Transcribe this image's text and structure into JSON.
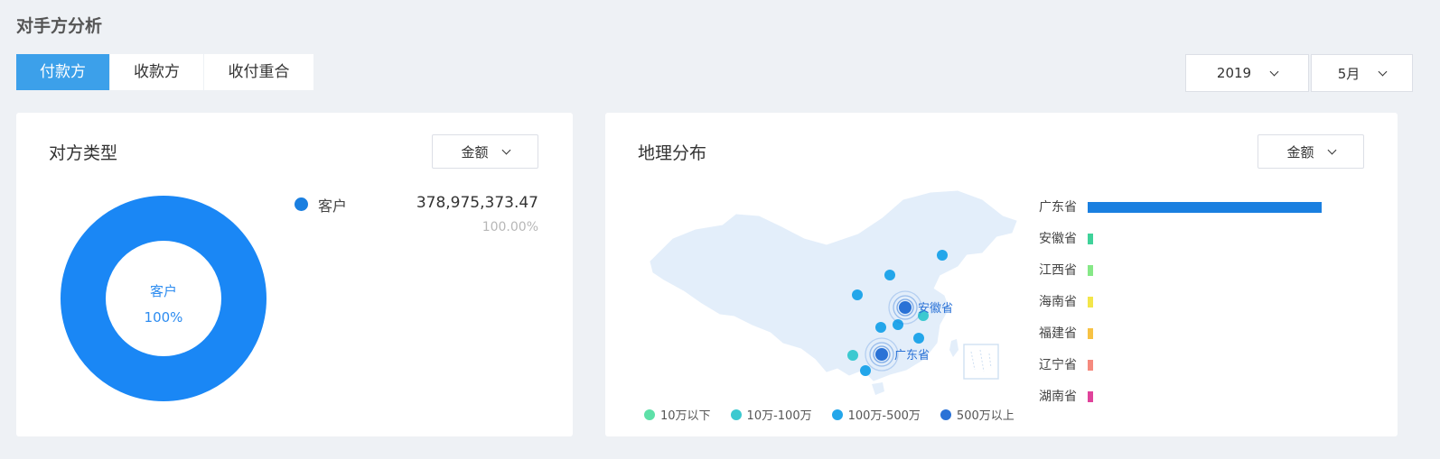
{
  "page": {
    "title": "对手方分析"
  },
  "tabs": [
    {
      "label": "付款方",
      "active": true
    },
    {
      "label": "收款方",
      "active": false
    },
    {
      "label": "收付重合",
      "active": false
    }
  ],
  "filters": {
    "year": "2019",
    "month": "5月"
  },
  "left_card": {
    "title": "对方类型",
    "metric_select": "金额",
    "donut": {
      "center_name": "客户",
      "center_pct": "100%",
      "color": "#1a87f5"
    },
    "legend": {
      "name": "客户",
      "value": "378,975,373.47",
      "percent": "100.00%",
      "color": "#1a7fe0"
    }
  },
  "right_card": {
    "title": "地理分布",
    "metric_select": "金额",
    "map_labels": {
      "anhui": "安徽省",
      "guangdong": "广东省"
    },
    "map_legend": [
      {
        "label": "10万以下",
        "color": "#5ee0a8"
      },
      {
        "label": "10万-100万",
        "color": "#3cc9d0"
      },
      {
        "label": "100万-500万",
        "color": "#23a6ea"
      },
      {
        "label": "500万以上",
        "color": "#2a72d6"
      }
    ],
    "provinces": [
      {
        "name": "广东省",
        "share": 1.0,
        "color": "#1a7fe0"
      },
      {
        "name": "安徽省",
        "share": 0.0,
        "color": "#3fd29a"
      },
      {
        "name": "江西省",
        "share": 0.0,
        "color": "#86e887"
      },
      {
        "name": "海南省",
        "share": 0.0,
        "color": "#f3e64a"
      },
      {
        "name": "福建省",
        "share": 0.0,
        "color": "#f7c244"
      },
      {
        "name": "辽宁省",
        "share": 0.0,
        "color": "#f58a7e"
      },
      {
        "name": "湖南省",
        "share": 0.0,
        "color": "#e0439b"
      }
    ]
  }
}
